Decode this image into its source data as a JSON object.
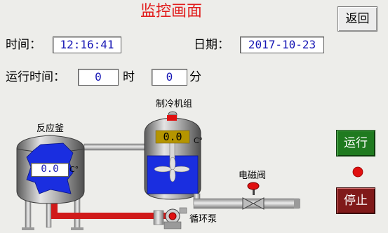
{
  "header": {
    "title": "监控画面",
    "return_label": "返回"
  },
  "info": {
    "time_label": "时间：",
    "time_value": "12:16:41",
    "date_label": "日期：",
    "date_value": "2017-10-23",
    "runtime_label": "运行时间：",
    "hours_value": "0",
    "hours_unit": "时",
    "minutes_value": "0",
    "minutes_unit": "分"
  },
  "equipment": {
    "reactor_label": "反应釜",
    "reactor_temp": "0.0",
    "reactor_unit": "C°",
    "chiller_label": "制冷机组",
    "chiller_temp": "0.0",
    "chiller_unit": "C°",
    "valve_label": "电磁阀",
    "pump_label": "循环泵"
  },
  "controls": {
    "run_label": "运行",
    "stop_label": "停止"
  },
  "colors": {
    "accent_red": "#e11b1b",
    "run_green": "#1f7a1f",
    "stop_red": "#801a1a",
    "indicator": "#e01010",
    "fluid_blue": "#1a2ee0",
    "pipe_red": "#d01a1a"
  }
}
